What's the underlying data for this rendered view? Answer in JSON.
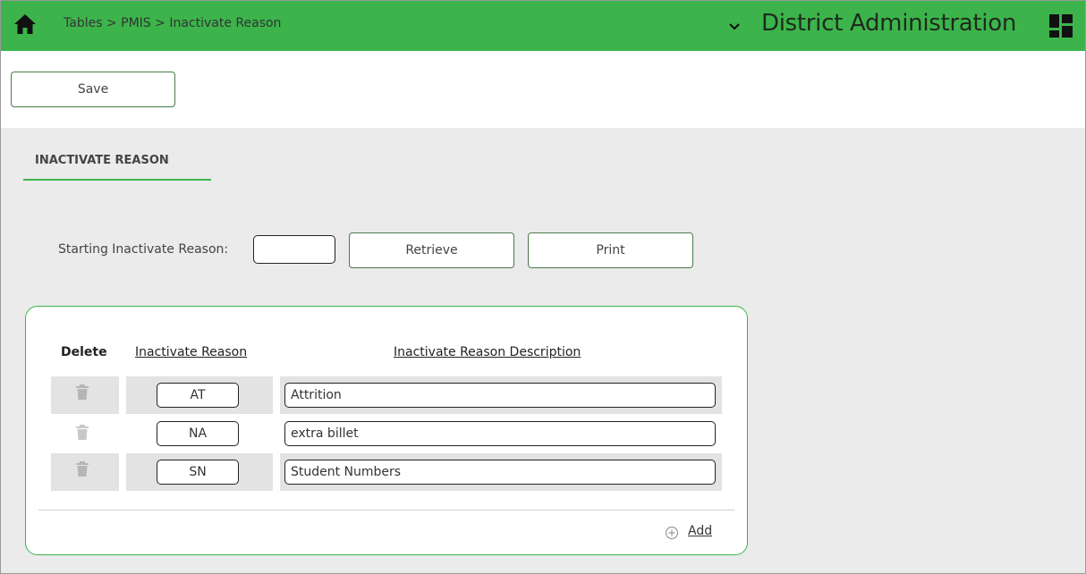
{
  "header": {
    "breadcrumb": [
      "Tables",
      "PMIS",
      "Inactivate Reason"
    ],
    "breadcrumb_sep": " > ",
    "app_title": "District Administration",
    "accent_color": "#3cb44b"
  },
  "toolbar": {
    "save_label": "Save"
  },
  "section": {
    "tab_label": "INACTIVATE REASON"
  },
  "filter": {
    "label": "Starting Inactivate Reason:",
    "value": "",
    "retrieve_label": "Retrieve",
    "print_label": "Print"
  },
  "grid": {
    "headers": {
      "delete": "Delete",
      "code": "Inactivate Reason",
      "description": "Inactivate Reason Description"
    },
    "rows": [
      {
        "code": "AT",
        "description": "Attrition"
      },
      {
        "code": "NA",
        "description": "extra billet"
      },
      {
        "code": "SN",
        "description": "Student Numbers"
      }
    ],
    "add_label": "Add"
  },
  "icons": {
    "home": "home-icon",
    "chevron": "chevron-down-icon",
    "apps": "grid-icon",
    "delete": "trash-icon",
    "add": "plus-circle-icon"
  }
}
